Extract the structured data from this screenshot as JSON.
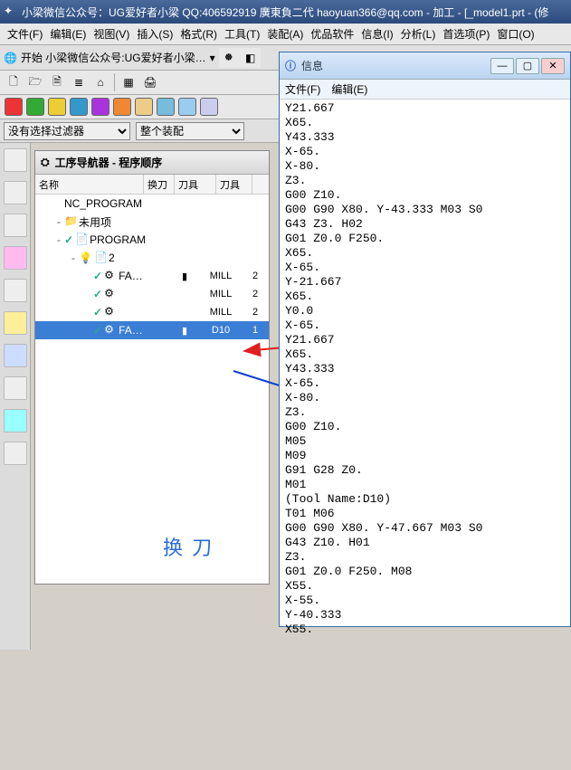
{
  "titlebar": {
    "text": "小梁微信公众号：UG爱好者小梁 QQ:406592919 廣東負二代 haoyuan366@qq.com - 加工 - [_model1.prt - (修"
  },
  "menubar": [
    "文件(F)",
    "编辑(E)",
    "视图(V)",
    "插入(S)",
    "格式(R)",
    "工具(T)",
    "装配(A)",
    "优品软件",
    "信息(I)",
    "分析(L)",
    "首选项(P)",
    "窗口(O)"
  ],
  "start_row": {
    "label": "开始 小梁微信公众号:UG爱好者小梁… "
  },
  "filter": {
    "sel1": "没有选择过滤器",
    "sel2": "整个装配"
  },
  "nav": {
    "title": "工序导航器 - 程序顺序",
    "columns": [
      "名称",
      "换刀",
      "刀具",
      "刀具"
    ],
    "rows": [
      {
        "indent": 0,
        "exp": "",
        "icon": "",
        "text": "NC_PROGRAM",
        "tool": "",
        "tc": "",
        "sel": false
      },
      {
        "indent": 1,
        "exp": "-",
        "icon": "folder",
        "text": "未用项",
        "tool": "",
        "tc": "",
        "sel": false
      },
      {
        "indent": 1,
        "exp": "-",
        "icon": "prog",
        "text": "PROGRAM",
        "tick": true,
        "tool": "",
        "tc": "",
        "sel": false
      },
      {
        "indent": 2,
        "exp": "-",
        "icon": "prog",
        "text": "2",
        "bulb": true,
        "tool": "",
        "tc": "",
        "sel": false
      },
      {
        "indent": 3,
        "exp": "",
        "icon": "op",
        "text": "FA…",
        "tick": true,
        "tool": "MILL",
        "tc": "2",
        "toolico": true,
        "sel": false
      },
      {
        "indent": 3,
        "exp": "",
        "icon": "op",
        "text": "",
        "tick": true,
        "tool": "MILL",
        "tc": "2",
        "sel": false
      },
      {
        "indent": 3,
        "exp": "",
        "icon": "op",
        "text": "",
        "tick": true,
        "tool": "MILL",
        "tc": "2",
        "sel": false
      },
      {
        "indent": 3,
        "exp": "",
        "icon": "op",
        "text": "FA…",
        "tick": true,
        "tool": "D10",
        "tc": "1",
        "toolico": true,
        "sel": true
      }
    ]
  },
  "annotation": "换 刀",
  "info": {
    "title": "信息",
    "menu": [
      "文件(F)",
      "编辑(E)"
    ],
    "lines": [
      "Y21.667",
      "X65.",
      "Y43.333",
      "X-65.",
      "X-80.",
      "Z3.",
      "G00 Z10.",
      "G00 G90 X80. Y-43.333 M03 S0",
      "G43 Z3. H02",
      "G01 Z0.0 F250.",
      "X65.",
      "X-65.",
      "Y-21.667",
      "X65.",
      "Y0.0",
      "X-65.",
      "Y21.667",
      "X65.",
      "Y43.333",
      "X-65.",
      "X-80.",
      "Z3.",
      "G00 Z10.",
      "M05",
      "M09",
      "G91 G28 Z0.",
      "M01",
      "(Tool Name:D10)",
      "T01 M06",
      "G00 G90 X80. Y-47.667 M03 S0",
      "G43 Z10. H01",
      "Z3.",
      "G01 Z0.0 F250. M08",
      "X55.",
      "X-55.",
      "Y-40.333",
      "X55."
    ]
  },
  "color_buttons": [
    "#e33",
    "#3a3",
    "#ec3",
    "#39c",
    "#a3d",
    "#e83",
    "#ec8",
    "#7bd",
    "#9ce",
    "#cce"
  ],
  "icons": {
    "app": "✦",
    "info": "i",
    "folder": "📁",
    "prog": "📄",
    "op": "⚙",
    "tool": "▮",
    "tick": "✓",
    "bulb": "💡"
  }
}
